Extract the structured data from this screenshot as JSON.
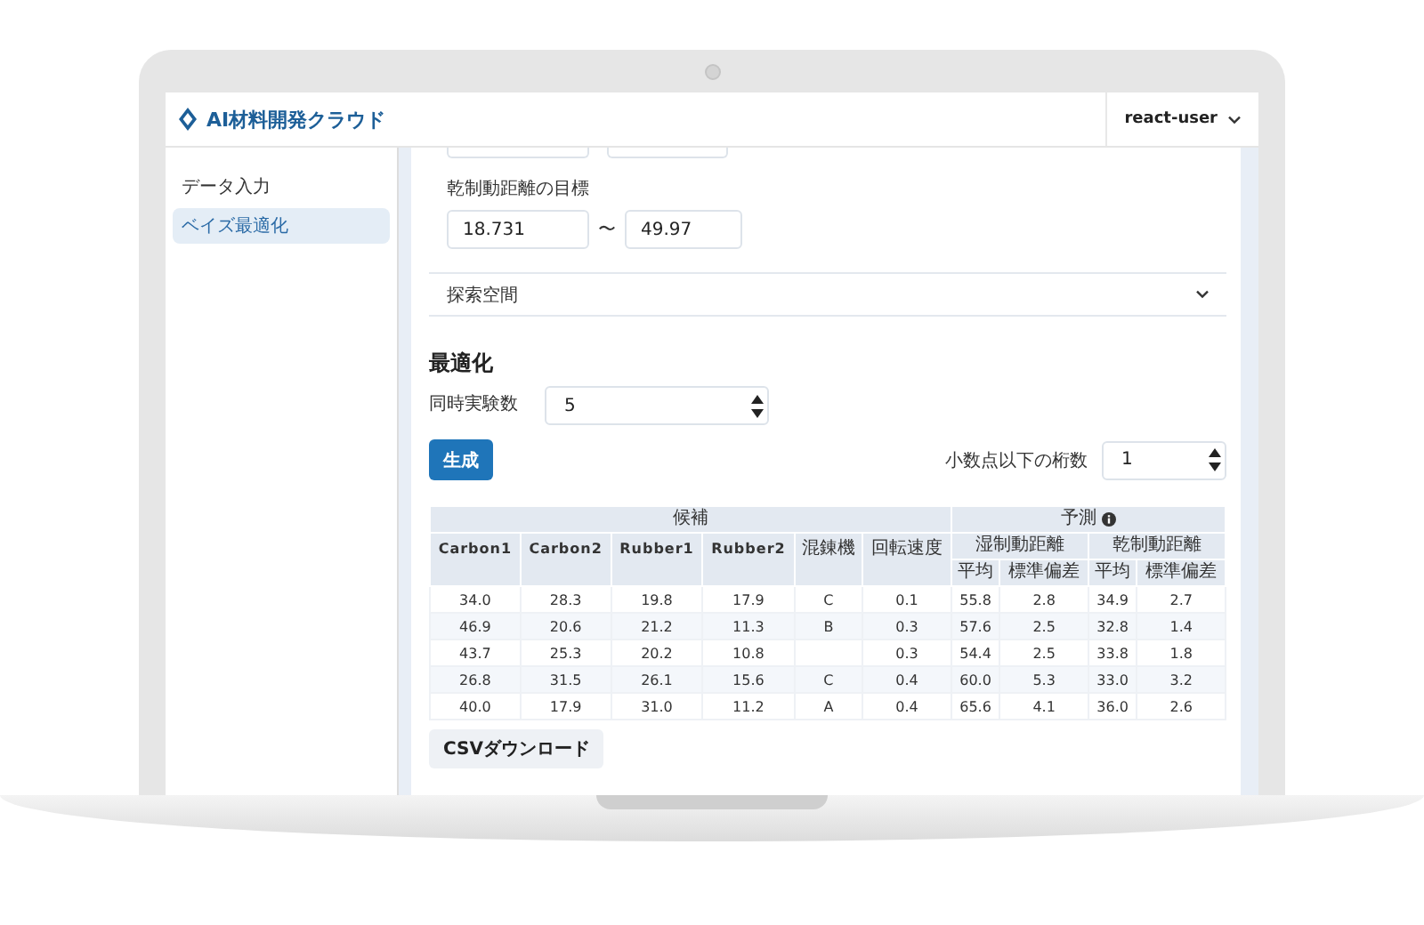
{
  "app": {
    "title": "AI材料開発クラウド",
    "user": "react-user"
  },
  "sidebar": {
    "items": [
      {
        "label": "データ入力",
        "selected": false
      },
      {
        "label": "ベイズ最適化",
        "selected": true
      }
    ]
  },
  "dry_target": {
    "label": "乾制動距離の目標",
    "min": "18.731",
    "separator": "〜",
    "max": "49.97"
  },
  "search_space": {
    "label": "探索空間",
    "expanded": false
  },
  "optimization": {
    "heading": "最適化",
    "parallel_label": "同時実験数",
    "parallel_value": "5",
    "generate_button": "生成",
    "decimals_label": "小数点以下の桁数",
    "decimals_value": "1"
  },
  "table": {
    "candidates": {
      "label": "候補",
      "columns": [
        "Carbon1",
        "Carbon2",
        "Rubber1",
        "Rubber2",
        "混錬機",
        "回転速度"
      ]
    },
    "predictions": {
      "label": "予測",
      "targets": [
        {
          "label": "湿制動距離",
          "stats": [
            "平均",
            "標準偏差"
          ]
        },
        {
          "label": "乾制動距離",
          "stats": [
            "平均",
            "標準偏差"
          ]
        }
      ]
    },
    "rows": [
      [
        "34.0",
        "28.3",
        "19.8",
        "17.9",
        "C",
        "0.1",
        "55.8",
        "2.8",
        "34.9",
        "2.7"
      ],
      [
        "46.9",
        "20.6",
        "21.2",
        "11.3",
        "B",
        "0.3",
        "57.6",
        "2.5",
        "32.8",
        "1.4"
      ],
      [
        "43.7",
        "25.3",
        "20.2",
        "10.8",
        null,
        "0.3",
        "54.4",
        "2.5",
        "33.8",
        "1.8"
      ],
      [
        "26.8",
        "31.5",
        "26.1",
        "15.6",
        "C",
        "0.4",
        "60.0",
        "5.3",
        "33.0",
        "3.2"
      ],
      [
        "40.0",
        "17.9",
        "31.0",
        "11.2",
        "A",
        "0.4",
        "65.6",
        "4.1",
        "36.0",
        "2.6"
      ]
    ]
  },
  "csv_button": "CSVダウンロード"
}
